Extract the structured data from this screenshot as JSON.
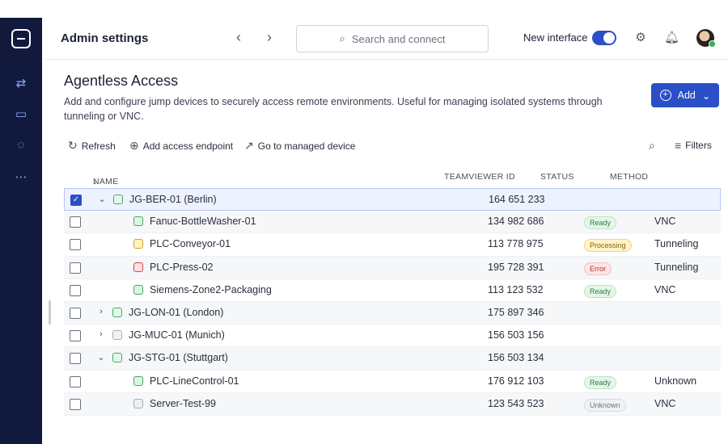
{
  "header": {
    "title": "Admin settings",
    "search_placeholder": "Search and connect",
    "new_interface_label": "New interface",
    "new_interface_on": true
  },
  "page": {
    "title": "Agentless Access",
    "description": "Add and configure jump devices to securely access remote environments. Useful for managing isolated systems through tunneling or VNC.",
    "add_label": "Add"
  },
  "toolbar": {
    "refresh": "Refresh",
    "add_endpoint": "Add access endpoint",
    "go_managed": "Go to managed device",
    "filters": "Filters"
  },
  "table": {
    "columns": {
      "name": "NAME",
      "teamviewer_id": "TEAMVIEWER ID",
      "status": "STATUS",
      "method": "METHOD"
    },
    "rows": [
      {
        "name": "JG-BER-01 (Berlin)",
        "id": "164 651 233",
        "status": "",
        "method": "",
        "level": 0,
        "expanded": true,
        "selected": true,
        "icon": "group"
      },
      {
        "name": "Fanuc-BottleWasher-01",
        "id": "134 982 686",
        "status": "Ready",
        "method": "VNC",
        "level": 1,
        "icon": "ok"
      },
      {
        "name": "PLC-Conveyor-01",
        "id": "113 778 975",
        "status": "Processing",
        "method": "Tunneling",
        "level": 1,
        "icon": "warn"
      },
      {
        "name": "PLC-Press-02",
        "id": "195 728 391",
        "status": "Error",
        "method": "Tunneling",
        "level": 1,
        "icon": "err"
      },
      {
        "name": "Siemens-Zone2-Packaging",
        "id": "113 123 532",
        "status": "Ready",
        "method": "VNC",
        "level": 1,
        "icon": "ok"
      },
      {
        "name": "JG-LON-01 (London)",
        "id": "175 897 346",
        "status": "",
        "method": "",
        "level": 0,
        "expanded": false,
        "icon": "group"
      },
      {
        "name": "JG-MUC-01 (Munich)",
        "id": "156 503 156",
        "status": "",
        "method": "",
        "level": 0,
        "expanded": false,
        "icon": "group-off"
      },
      {
        "name": "JG-STG-01 (Stuttgart)",
        "id": "156 503 134",
        "status": "",
        "method": "",
        "level": 0,
        "expanded": true,
        "icon": "group"
      },
      {
        "name": "PLC-LineControl-01",
        "id": "176 912 103",
        "status": "Ready",
        "method": "Unknown",
        "level": 1,
        "icon": "ok"
      },
      {
        "name": "Server-Test-99",
        "id": "123 543 523",
        "status": "Unknown",
        "method": "VNC",
        "level": 1,
        "icon": "unk"
      }
    ]
  },
  "colors": {
    "sidebar": "#111a3d",
    "accent": "#2b4fc6",
    "ready": "#3fae5c",
    "processing": "#d6a316",
    "error": "#d24747"
  }
}
